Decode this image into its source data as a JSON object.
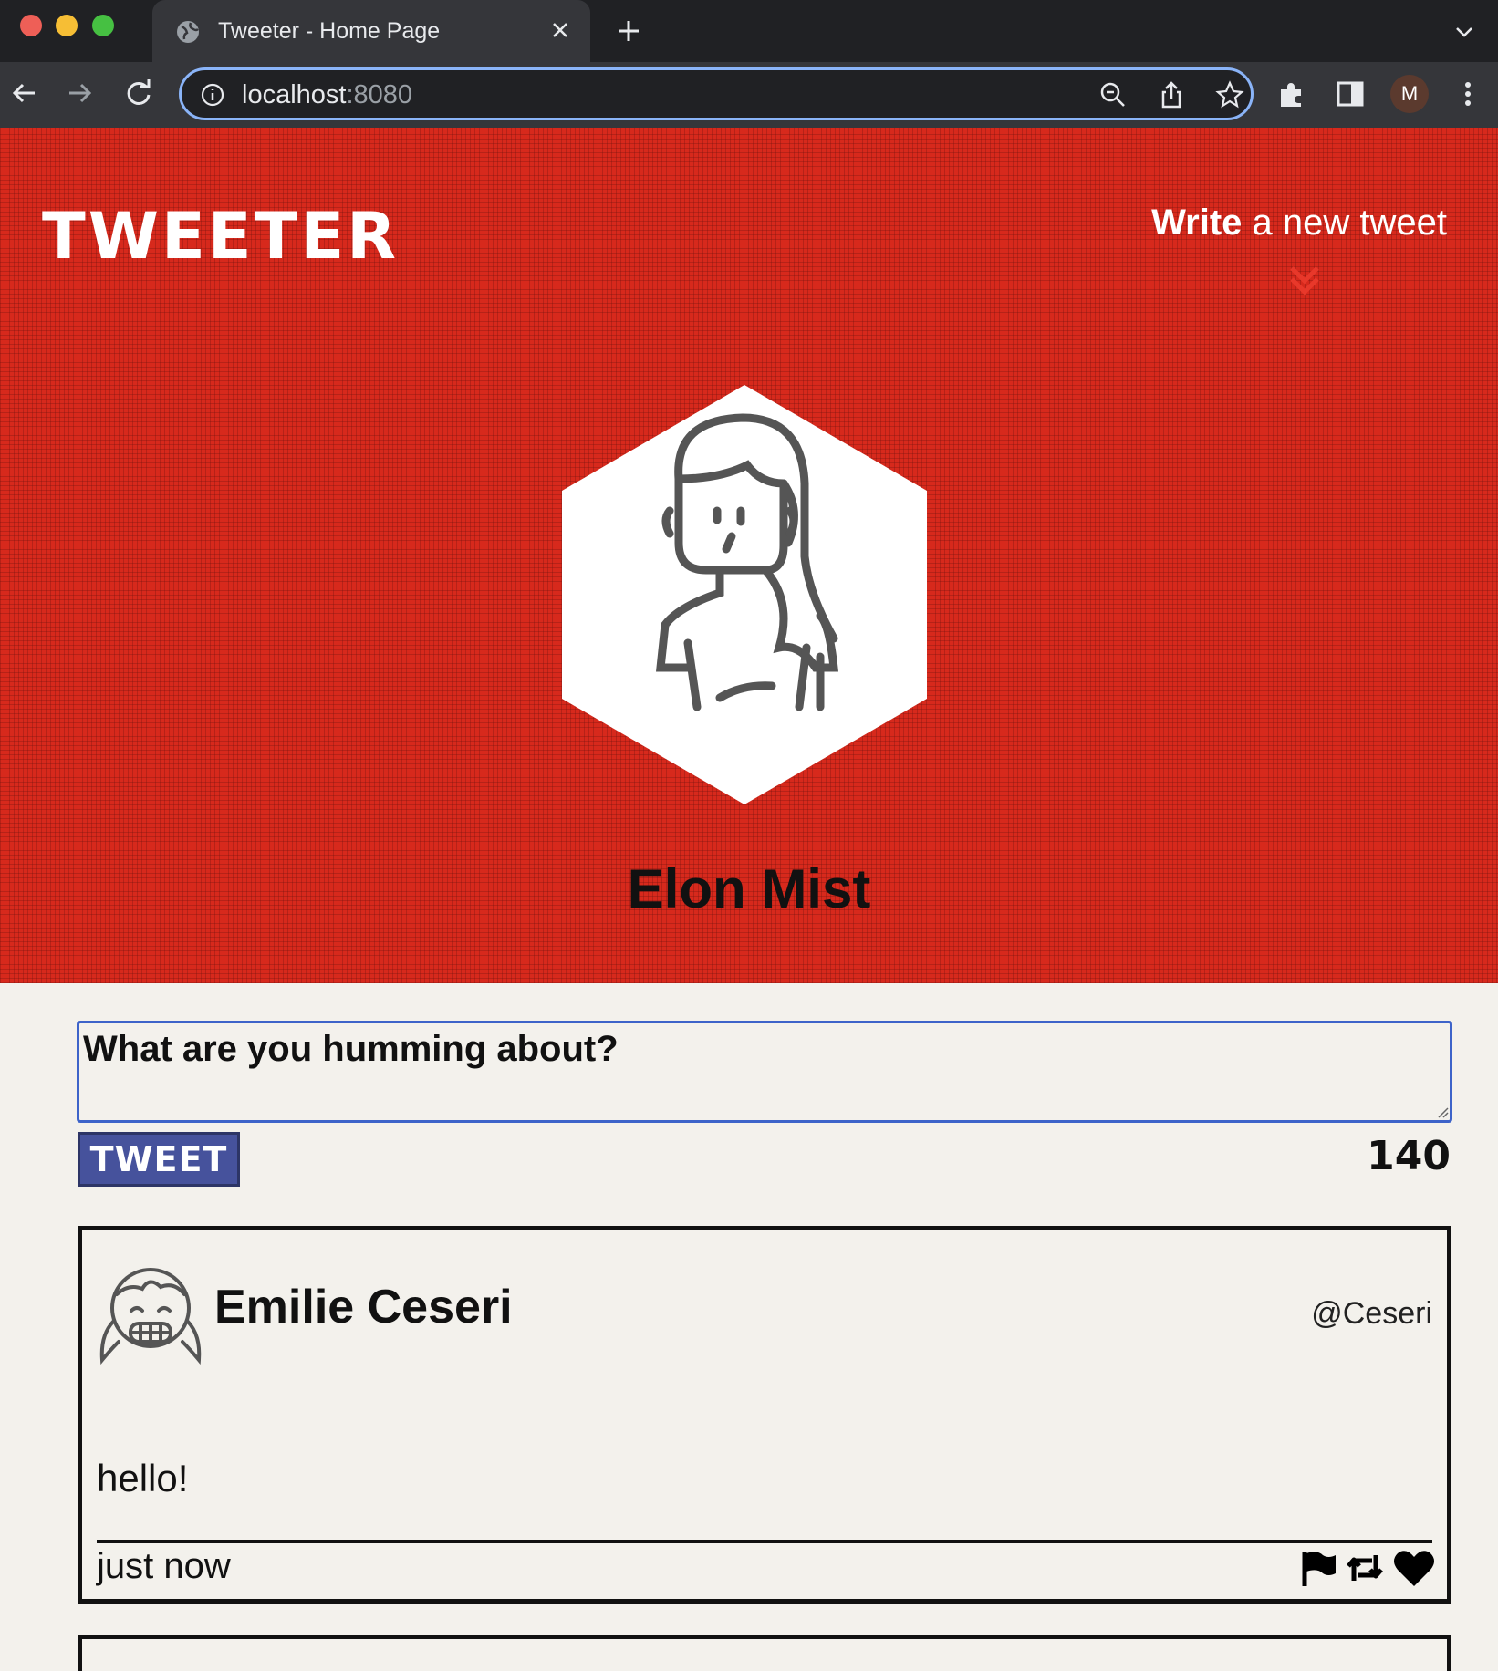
{
  "browser": {
    "tab_title": "Tweeter - Home Page",
    "url_host": "localhost",
    "url_port": ":8080",
    "profile_initial": "M",
    "icons": [
      "globe-icon",
      "close-icon",
      "plus-icon",
      "chevron-down-icon",
      "back-arrow-icon",
      "forward-arrow-icon",
      "reload-icon",
      "info-icon",
      "zoom-icon",
      "share-icon",
      "star-icon",
      "extensions-icon",
      "sidepanel-icon",
      "kebab-menu-icon"
    ]
  },
  "header": {
    "logo": "TWEETER",
    "compose_bold": "Write",
    "compose_rest": " a new tweet",
    "profile_name": "Elon Mist"
  },
  "compose": {
    "placeholder": "What are you humming about?",
    "button_label": "TWEET",
    "counter": "140"
  },
  "tweets": [
    {
      "name": "Emilie Ceseri",
      "handle": "@Ceseri",
      "content": "hello!",
      "time": "just now"
    }
  ],
  "colors": {
    "header_red": "#d7291c",
    "page_bg": "#f3f1ec",
    "tweet_button": "#46529c",
    "chevron": "#d7291c"
  }
}
